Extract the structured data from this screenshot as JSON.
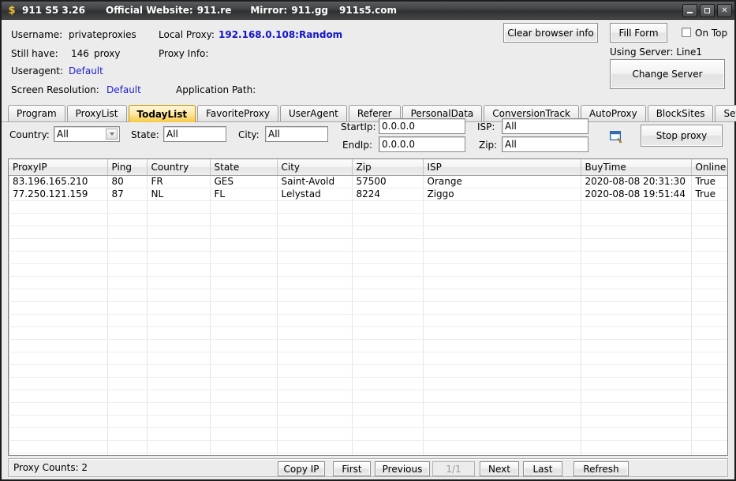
{
  "titlebar": {
    "icon": "dollar-icon",
    "app_version": "911 S5 3.26",
    "official_site_label": "Official Website:",
    "official_site": "911.re",
    "mirror_label": "Mirror:",
    "mirror1": "911.gg",
    "mirror2": "911s5.com",
    "minimize": "minimize-icon",
    "maximize": "maximize-icon",
    "close": "✕"
  },
  "info": {
    "username_label": "Username:",
    "username_value": "privateproxies",
    "stillhave_label": "Still have:",
    "stillhave_value": "146",
    "stillhave_unit": "proxy",
    "useragent_label": "Useragent:",
    "useragent_value": "Default",
    "screenres_label": "Screen Resolution:",
    "screenres_value": "Default",
    "localproxy_label": "Local Proxy:",
    "localproxy_value": "192.168.0.108:Random",
    "proxyinfo_label": "Proxy Info:",
    "proxyinfo_value": "",
    "apppath_label": "Application Path:",
    "apppath_value": ""
  },
  "actions": {
    "clear_browser_info": "Clear browser info",
    "fill_form": "Fill Form",
    "on_top": "On Top",
    "on_top_checked": false,
    "using_server": "Using Server: Line1",
    "change_server": "Change Server"
  },
  "tabs": [
    {
      "label": "Program",
      "active": false
    },
    {
      "label": "ProxyList",
      "active": false
    },
    {
      "label": "TodayList",
      "active": true
    },
    {
      "label": "FavoriteProxy",
      "active": false
    },
    {
      "label": "UserAgent",
      "active": false
    },
    {
      "label": "Referer",
      "active": false
    },
    {
      "label": "PersonalData",
      "active": false
    },
    {
      "label": "ConversionTrack",
      "active": false
    },
    {
      "label": "AutoProxy",
      "active": false
    },
    {
      "label": "BlockSites",
      "active": false
    },
    {
      "label": "Settings",
      "active": false
    }
  ],
  "filters": {
    "country_label": "Country:",
    "country_value": "All",
    "state_label": "State:",
    "state_value": "All",
    "city_label": "City:",
    "city_value": "All",
    "startip_label": "StartIp:",
    "startip_value": "0.0.0.0",
    "endip_label": "EndIp:",
    "endip_value": "0.0.0.0",
    "isp_label": "ISP:",
    "isp_value": "All",
    "zip_label": "Zip:",
    "zip_value": "All",
    "search_icon": "search-window-icon",
    "stop_proxy": "Stop proxy"
  },
  "grid": {
    "columns": [
      "ProxyIP",
      "Ping",
      "Country",
      "State",
      "City",
      "Zip",
      "ISP",
      "BuyTime",
      "Online"
    ],
    "rows": [
      [
        "83.196.165.210",
        "80",
        "FR",
        "GES",
        "Saint-Avold",
        "57500",
        "Orange",
        "2020-08-08 20:31:30",
        "True"
      ],
      [
        "77.250.121.159",
        "87",
        "NL",
        "FL",
        "Lelystad",
        "8224",
        "Ziggo",
        "2020-08-08 19:51:44",
        "True"
      ]
    ],
    "empty_row_count": 22
  },
  "status": {
    "proxy_counts": "Proxy Counts: 2",
    "copy_ip": "Copy IP",
    "first": "First",
    "previous": "Previous",
    "page_indicator": "1/1",
    "next": "Next",
    "last": "Last",
    "refresh": "Refresh"
  },
  "colors": {
    "accent_tab": "#f6c945",
    "link_blue": "#2222cc",
    "value_blue": "#1414c8",
    "window_bg": "#ececec",
    "titlebar_dark": "#3e4042"
  }
}
